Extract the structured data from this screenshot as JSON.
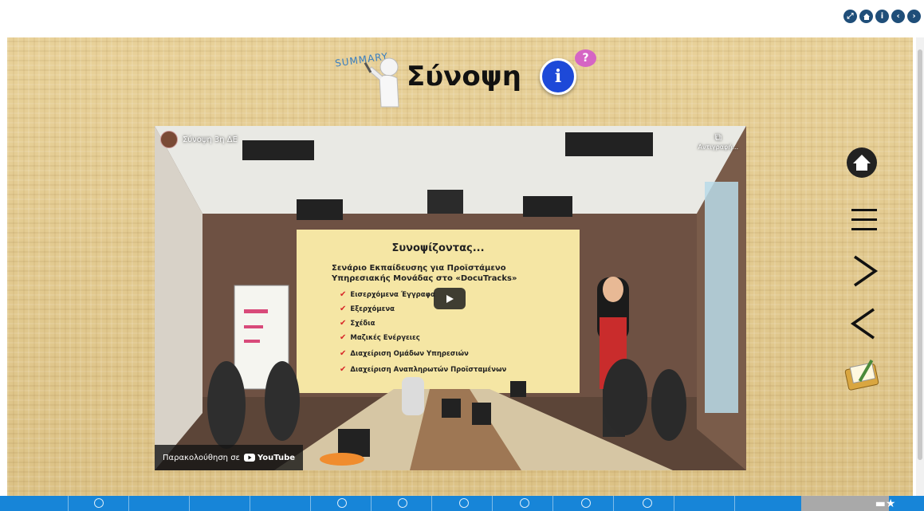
{
  "top_nav": {
    "icons": [
      "fullscreen-icon",
      "home-icon",
      "info-icon",
      "chevron-left-icon",
      "chevron-right-icon"
    ],
    "color": "#1f4e79"
  },
  "header": {
    "summary_word": "SUMMARY",
    "title": "Σύνοψη",
    "info_glyph": "i",
    "help_glyph": "?"
  },
  "video": {
    "title": "Σύνοψη 3η ΔΕ",
    "copy_label": "Αντιγραφή...",
    "watch_on": "Παρακολούθηση σε",
    "youtube_label": "YouTube",
    "slide": {
      "heading": "Συνοψίζοντας...",
      "subtitle": "Σενάριο Εκπαίδευσης για Προϊστάμενο Υπηρεσιακής Μονάδας στο «DocuTracks»",
      "items": [
        "Εισερχόμενα Έγγραφα",
        "Εξερχόμενα",
        "Σχέδια",
        "Μαζικές Ενέργειες",
        "Διαχείριση Ομάδων Υπηρεσιών",
        "Διαχείριση Αναπληρωτών Προϊσταμένων"
      ]
    }
  },
  "side_controls": [
    "home-icon",
    "menu-icon",
    "next-icon",
    "previous-icon",
    "notebook-icon"
  ],
  "colors": {
    "accent_blue": "#1785d8",
    "info_blue": "#1d49d8",
    "help_pink": "#d565c4",
    "check_red": "#d8282a"
  }
}
